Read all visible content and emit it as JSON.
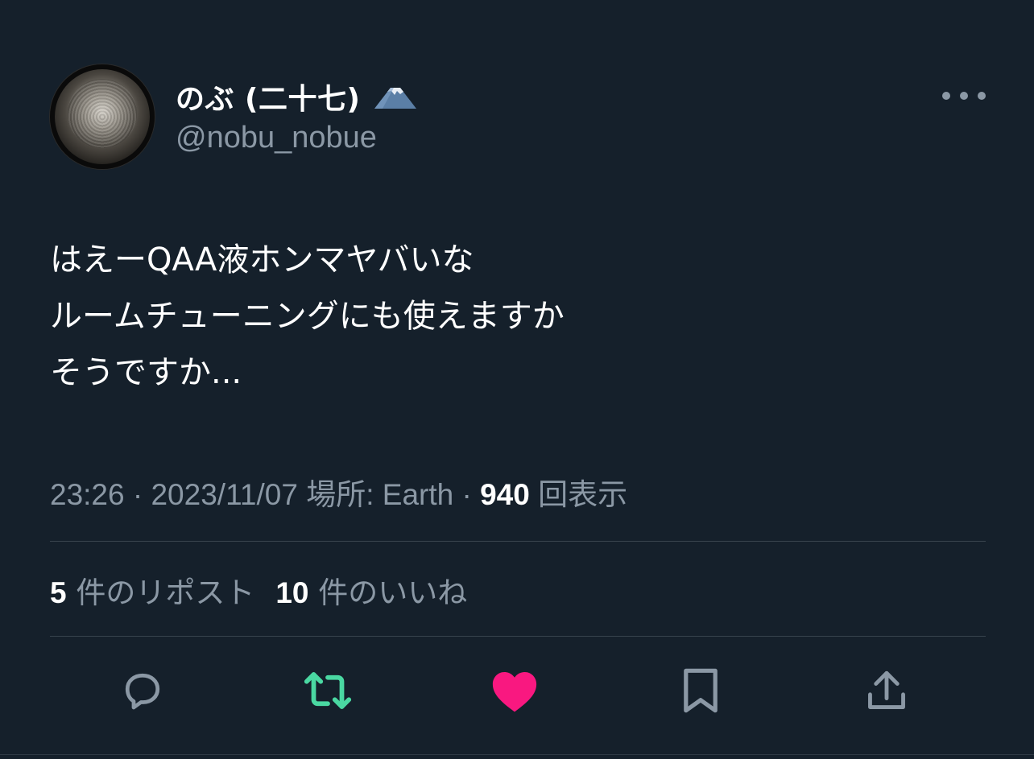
{
  "user": {
    "display_name": "のぶ (二十七)",
    "handle": "@nobu_nobue"
  },
  "tweet": {
    "text": "はえーQAA液ホンマヤバいな\nルームチューニングにも使えますか\nそうですか..."
  },
  "meta": {
    "time": "23:26",
    "sep1": " · ",
    "date": "2023/11/07",
    "location": " 場所: Earth",
    "sep2": " · ",
    "views_count": "940",
    "views_label": " 回表示"
  },
  "stats": {
    "reposts_count": "5",
    "reposts_label": " 件のリポスト",
    "likes_count": "10",
    "likes_label": " 件のいいね"
  },
  "icons": {
    "more": "more-horizontal-icon",
    "reply": "reply-icon",
    "repost": "repost-icon",
    "like": "heart-icon",
    "bookmark": "bookmark-icon",
    "share": "share-icon",
    "name_emoji": "mount-fuji-icon"
  },
  "colors": {
    "background": "#15202b",
    "secondary_text": "#8b98a5",
    "repost_active": "#4ad8a2",
    "like_active": "#f91880"
  }
}
